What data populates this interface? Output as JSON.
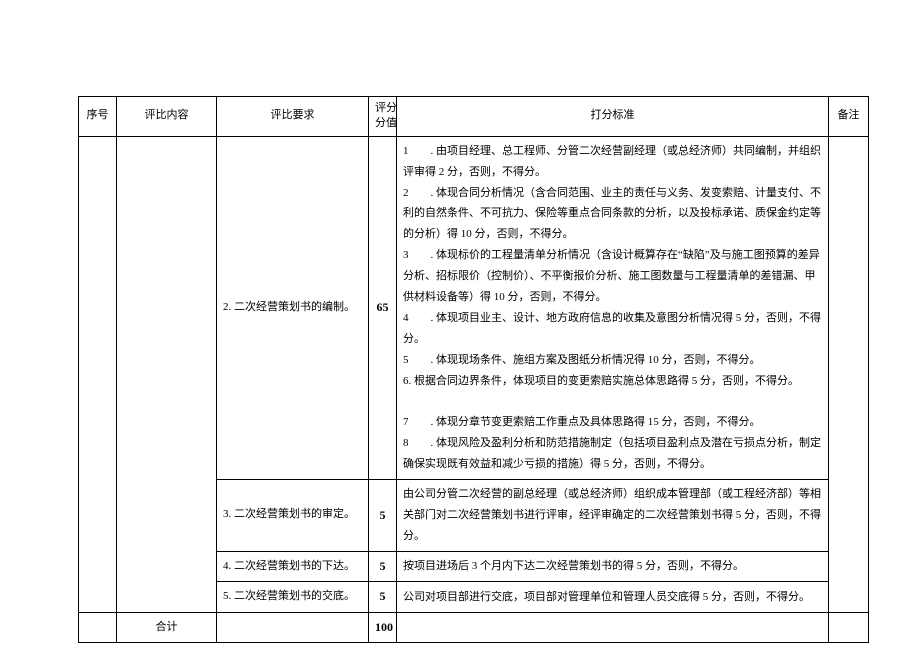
{
  "headers": {
    "seq": "序号",
    "content": "评比内容",
    "req": "评比要求",
    "score": "评分\n分值",
    "std": "打分标准",
    "remark": "备注"
  },
  "rows": [
    {
      "req": "2. 二次经营策划书的编制。",
      "score": "65",
      "std": "1　　. 由项目经理、总工程师、分管二次经营副经理（或总经济师）共同编制，并组织评审得 2 分，否则，不得分。\n2　　. 体现合同分析情况（含合同范围、业主的责任与义务、发变索赔、计量支付、不利的自然条件、不可抗力、保险等重点合同条款的分析，以及投标承诺、质保金约定等的分析）得 10 分，否则，不得分。\n3　　. 体现标价的工程量清单分析情况（含设计概算存在“缺陷”及与施工图预算的差异分析、招标限价（控制价）、不平衡报价分析、施工图数量与工程量清单的差错漏、甲供材料设备等）得 10 分，否则，不得分。\n4　　. 体现项目业主、设计、地方政府信息的收集及意图分析情况得 5 分，否则，不得分。\n5　　. 体现现场条件、施组方案及图纸分析情况得 10 分，否则，不得分。\n6. 根据合同边界条件，体现项目的变更索赔实施总体思路得 5 分，否则，不得分。\n\n7　　. 体现分章节变更索赔工作重点及具体思路得 15 分，否则，不得分。\n8　　. 体现风险及盈利分析和防范措施制定（包括项目盈利点及潜在亏损点分析，制定确保实现既有效益和减少亏损的措施）得 5 分，否则，不得分。"
    },
    {
      "req": "3. 二次经营策划书的审定。",
      "score": "5",
      "std": "由公司分管二次经营的副总经理（或总经济师）组织成本管理部（或工程经济部）等相关部门对二次经营策划书进行评审，经评审确定的二次经营策划书得 5 分，否则，不得分。"
    },
    {
      "req": "4. 二次经营策划书的下达。",
      "score": "5",
      "std": "按项目进场后 3 个月内下达二次经营策划书的得 5 分，否则，不得分。"
    },
    {
      "req": "5. 二次经营策划书的交底。",
      "score": "5",
      "std": "公司对项目部进行交底，项目部对管理单位和管理人员交底得 5 分，否则，不得分。"
    }
  ],
  "total": {
    "label": "合计",
    "value": "100"
  }
}
